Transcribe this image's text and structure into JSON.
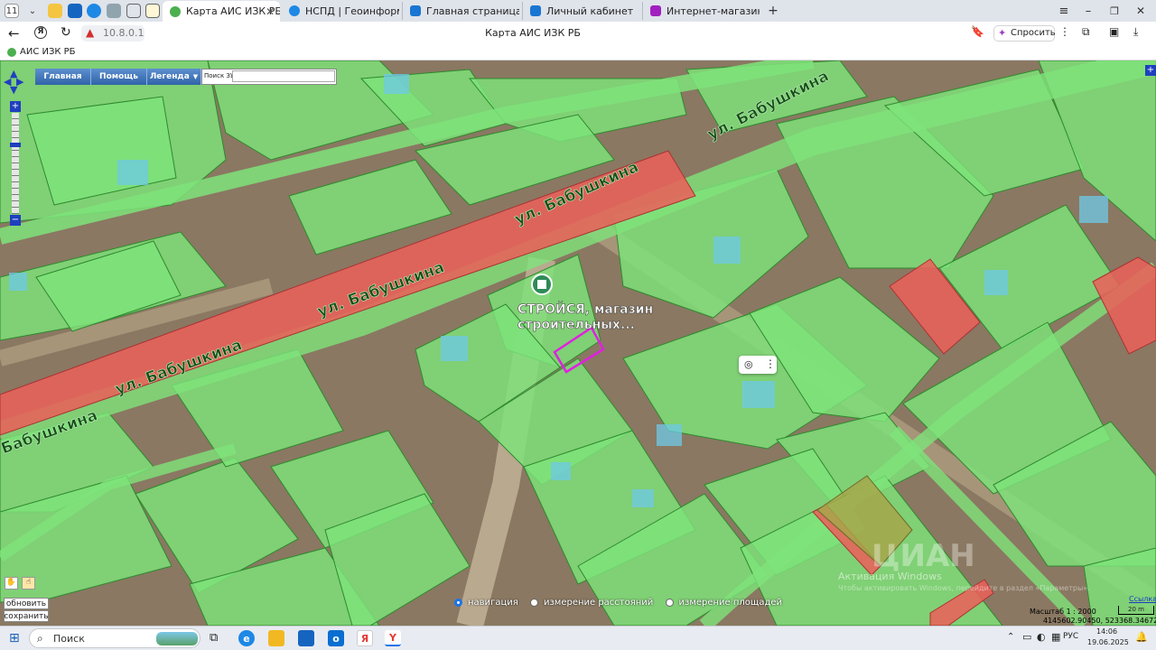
{
  "browser": {
    "tab_counter": "11",
    "tabs": [
      {
        "label": "Карта АИС ИЗК РБ",
        "active": true
      },
      {
        "label": "НСПД | Геоинформацион",
        "active": false
      },
      {
        "label": "Главная страница",
        "active": false
      },
      {
        "label": "Личный кабинет",
        "active": false
      },
      {
        "label": "Интернет-магазин Wildb",
        "active": false
      }
    ],
    "address": "10.8.0.1",
    "page_title": "Карта АИС ИЗК РБ",
    "ask_label": "Спросить",
    "bookmark": "АИС ИЗК РБ"
  },
  "map": {
    "nav_buttons": [
      "Главная",
      "Помощь",
      "Легенда"
    ],
    "search_label": "Поиск ЗУ",
    "search_value": "",
    "street_labels": [
      "ул. Бабушкина",
      "ул. Бабушкина",
      "ул. Бабушкина",
      "ул. Бабушкина",
      "ул. Бабушкина"
    ],
    "poi_line1": "СТРОЙСЯ, магазин",
    "poi_line2": "строительных...",
    "refresh_button": "обновить",
    "save_button": "сохранить",
    "modes": [
      {
        "label": "навигация",
        "selected": true
      },
      {
        "label": "измерение расстояний",
        "selected": false
      },
      {
        "label": "измерение площадей",
        "selected": false
      }
    ],
    "scale_text": "Масштаб 1 : 2000",
    "coords_text": "4145602.90450, 523368.34672",
    "scale_link": "Ссылка",
    "scale_bar_label": "20 m",
    "watermark": "ЦИАН",
    "activation_line1": "Активация Windows",
    "activation_line2": "Чтобы активировать Windows, перейдите в раздел «Параметры»."
  },
  "taskbar": {
    "search_placeholder": "Поиск",
    "language": "РУС",
    "time": "14:06",
    "date": "19.06.2025"
  },
  "colors": {
    "parcel_green": "#7ee37a",
    "road_red": "#e8615a",
    "highlight_magenta": "#e020e0",
    "nav_blue": "#2f64a8"
  }
}
